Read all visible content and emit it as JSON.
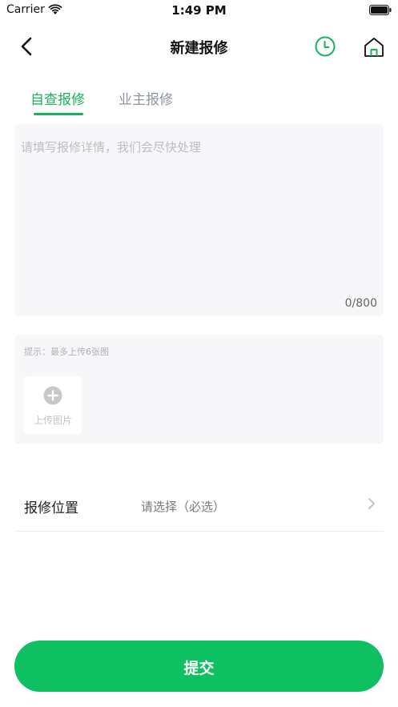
{
  "status_bar": {
    "carrier": "Carrier",
    "time": "1:49 PM"
  },
  "nav": {
    "title": "新建报修",
    "icons": [
      "back-icon",
      "clock-icon",
      "home-icon"
    ],
    "accent_color": "#18b35a"
  },
  "tabs": [
    {
      "label": "自查报修",
      "active": true
    },
    {
      "label": "业主报修",
      "active": false
    }
  ],
  "description": {
    "placeholder": "请填写报修详情，我们会尽快处理",
    "counter": "0/800"
  },
  "upload": {
    "hint": "提示：最多上传6张图",
    "tile_label": "上传图片"
  },
  "location": {
    "label": "报修位置",
    "value": "请选择（必选）"
  },
  "submit": {
    "label": "提交",
    "color": "#0ec062"
  }
}
